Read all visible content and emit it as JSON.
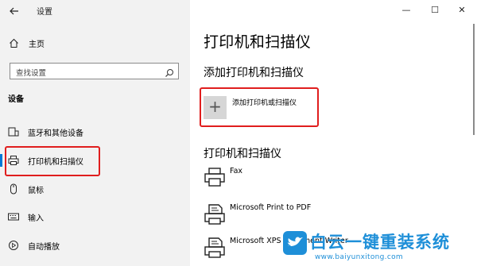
{
  "window": {
    "title": "设置",
    "controls": {
      "minimize": "—",
      "maximize": "☐",
      "close": "✕"
    }
  },
  "sidebar": {
    "home_label": "主页",
    "search_placeholder": "查找设置",
    "section_title": "设备",
    "items": [
      {
        "label": "蓝牙和其他设备",
        "icon": "bluetooth-devices-icon"
      },
      {
        "label": "打印机和扫描仪",
        "icon": "printer-icon",
        "active": true
      },
      {
        "label": "鼠标",
        "icon": "mouse-icon"
      },
      {
        "label": "输入",
        "icon": "keyboard-icon"
      },
      {
        "label": "自动播放",
        "icon": "autoplay-icon"
      }
    ]
  },
  "main": {
    "page_title": "打印机和扫描仪",
    "add_section_title": "添加打印机和扫描仪",
    "add_button_label": "添加打印机或扫描仪",
    "list_section_title": "打印机和扫描仪",
    "devices": [
      {
        "name": "Fax",
        "icon": "fax-icon"
      },
      {
        "name": "Microsoft Print to PDF",
        "icon": "printer-doc-icon"
      },
      {
        "name": "Microsoft XPS Document Writer",
        "icon": "printer-doc-icon"
      }
    ]
  },
  "watermark": {
    "text": "白云一键重装系统",
    "url": "www.baiyunxitong.com"
  },
  "colors": {
    "accent": "#0078d7",
    "highlight": "#e01e1e",
    "sidebar_bg": "#f2f2f2",
    "watermark": "#1e8fd8"
  }
}
